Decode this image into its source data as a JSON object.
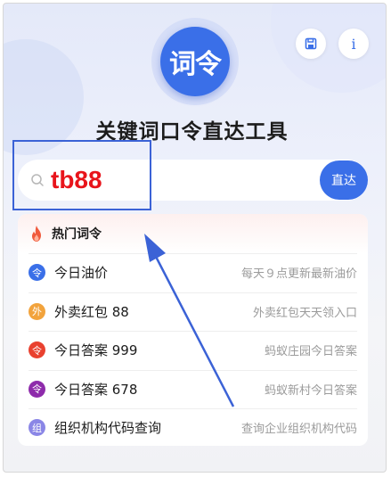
{
  "logo": {
    "text": "词令"
  },
  "header": {
    "info_label": "i",
    "save_icon": "save-icon"
  },
  "title": "关键词口令直达工具",
  "search": {
    "value": "tb88",
    "button_label": "直达",
    "icon": "search-icon"
  },
  "hot": {
    "label": "热门词令",
    "icon": "fire-icon",
    "items": [
      {
        "badge": "令",
        "badge_color": "#3a6fe8",
        "title": "今日油价",
        "desc": "每天９点更新最新油价"
      },
      {
        "badge": "外",
        "badge_color": "#f2a33c",
        "title": "外卖红包 88",
        "desc": "外卖红包天天领入口"
      },
      {
        "badge": "令",
        "badge_color": "#e9412f",
        "title": "今日答案 999",
        "desc": "蚂蚁庄园今日答案"
      },
      {
        "badge": "令",
        "badge_color": "#8e2bab",
        "title": "今日答案 678",
        "desc": "蚂蚁新村今日答案"
      },
      {
        "badge": "组",
        "badge_color": "#8a86e6",
        "title": "组织机构代码查询",
        "desc": "查询企业组织机构代码"
      }
    ]
  },
  "colors": {
    "accent": "#3a6fe8",
    "search_text": "#e8141b",
    "annotation": "#3b62d6"
  }
}
